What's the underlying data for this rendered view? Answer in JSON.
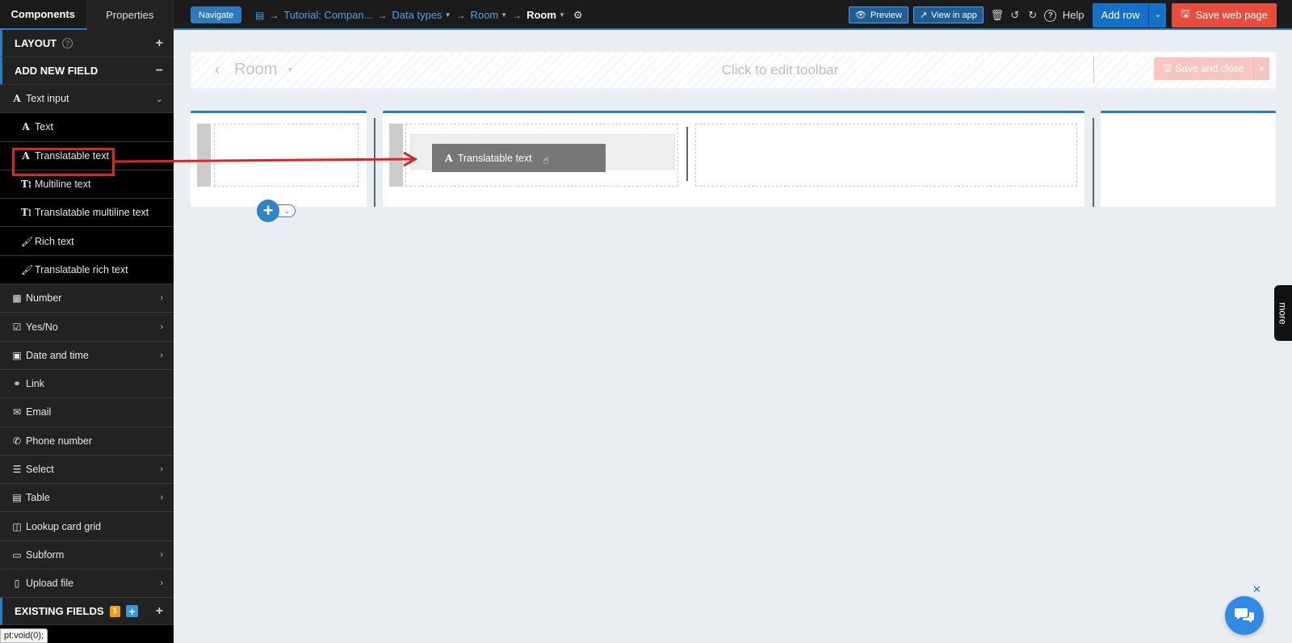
{
  "topbar": {
    "tabs": [
      {
        "label": "Components",
        "active": true
      },
      {
        "label": "Properties",
        "active": false
      }
    ],
    "navigate_label": "Navigate",
    "breadcrumb": [
      {
        "label": "Tutorial: Compan...",
        "caret": false
      },
      {
        "label": "Data types",
        "caret": true
      },
      {
        "label": "Room",
        "caret": true
      },
      {
        "label": "Room",
        "caret": true
      }
    ],
    "preview_label": "Preview",
    "view_in_app_label": "View in app",
    "help_label": "Help",
    "add_row_label": "Add row",
    "save_web_page_label": "Save web page"
  },
  "sidebar": {
    "layout_label": "LAYOUT",
    "add_new_field_label": "ADD NEW FIELD",
    "existing_fields_label": "EXISTING FIELDS",
    "existing_fields_count": "1",
    "text_input_label": "Text input",
    "text_input_children": [
      {
        "label": "Text",
        "icon": "A"
      },
      {
        "label": "Translatable text",
        "icon": "A"
      },
      {
        "label": "Multiline text",
        "icon": "T⁞"
      },
      {
        "label": "Translatable multiline text",
        "icon": "T⁞"
      },
      {
        "label": "Rich text",
        "icon": "brush"
      },
      {
        "label": "Translatable rich text",
        "icon": "brush"
      }
    ],
    "field_types": [
      {
        "label": "Number",
        "icon": "calculator-icon",
        "chevron": true
      },
      {
        "label": "Yes/No",
        "icon": "checkbox-icon",
        "chevron": true
      },
      {
        "label": "Date and time",
        "icon": "calendar-icon",
        "chevron": true
      },
      {
        "label": "Link",
        "icon": "link-icon",
        "chevron": false
      },
      {
        "label": "Email",
        "icon": "envelope-icon",
        "chevron": false
      },
      {
        "label": "Phone number",
        "icon": "phone-icon",
        "chevron": false
      },
      {
        "label": "Select",
        "icon": "list-icon",
        "chevron": true
      },
      {
        "label": "Table",
        "icon": "table-icon",
        "chevron": true
      },
      {
        "label": "Lookup card grid",
        "icon": "columns-icon",
        "chevron": false
      },
      {
        "label": "Subform",
        "icon": "card-icon",
        "chevron": true
      },
      {
        "label": "Upload file",
        "icon": "file-icon",
        "chevron": true
      }
    ],
    "status_url": "pt:void(0);"
  },
  "canvas": {
    "toolbar_title": "Room",
    "toolbar_hint": "Click to edit toolbar",
    "save_and_close_label": "Save and close",
    "drag_ghost_label": "Translatable text",
    "more_label": "more"
  },
  "colors": {
    "accent": "#2e7ac0",
    "danger": "#e74c3c",
    "annotation": "#e02424"
  }
}
